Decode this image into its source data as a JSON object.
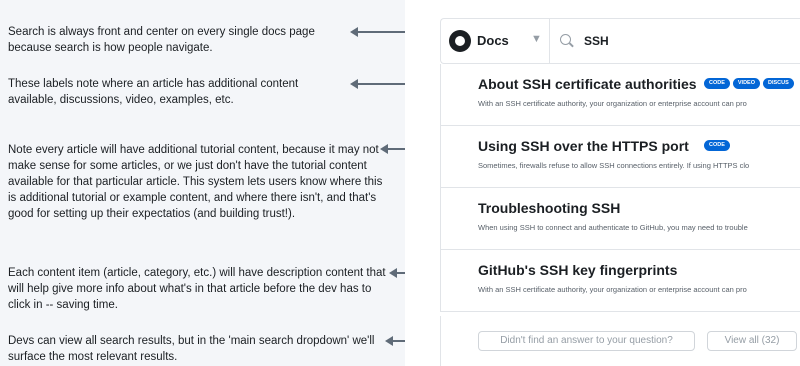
{
  "annotations": [
    {
      "text": "Search is always front and center on every single docs page because search is how people navigate."
    },
    {
      "text": "These labels note where an article has additional content available, discussions, video, examples, etc."
    },
    {
      "text": "Note every article will have additional tutorial content, because it may not make sense for some articles, or we just don't have the tutorial content available for that particular article. This system lets users know where this is additional tutorial or example content, and where there isn't, and that's good for setting up their expectatios (and building trust!)."
    },
    {
      "text": "Each content item (article, category, etc.) will have description content that will help give more info about what's in that article before the dev has to click in -- saving time."
    },
    {
      "text": "Devs can view all search results, but in the 'main search dropdown' we'll surface the most relevant results."
    }
  ],
  "header": {
    "brand": "Docs",
    "caret": "▼",
    "search_value": "SSH"
  },
  "results": [
    {
      "title": "About SSH certificate authorities",
      "description": "With an SSH certificate authority, your organization or enterprise account can pro",
      "badges": [
        "CODE",
        "VIDEO",
        "DISCUS"
      ]
    },
    {
      "title": "Using SSH over the HTTPS port",
      "description": "Sometimes, firewalls refuse to allow SSH connections entirely. If using HTTPS clo",
      "badges": [
        "CODE"
      ]
    },
    {
      "title": "Troubleshooting SSH",
      "description": "When using SSH to connect and authenticate to GitHub, you may need to trouble",
      "badges": []
    },
    {
      "title": "GitHub's SSH key fingerprints",
      "description": "With an SSH certificate authority, your organization or enterprise account can pro",
      "badges": []
    }
  ],
  "footer": {
    "feedback_label": "Didn't find an answer to your question?",
    "view_all_label": "View all (32)"
  },
  "colors": {
    "accent": "#0366d6",
    "annotation_bg": "#f4f6f9",
    "arrow": "#5f6b78"
  }
}
